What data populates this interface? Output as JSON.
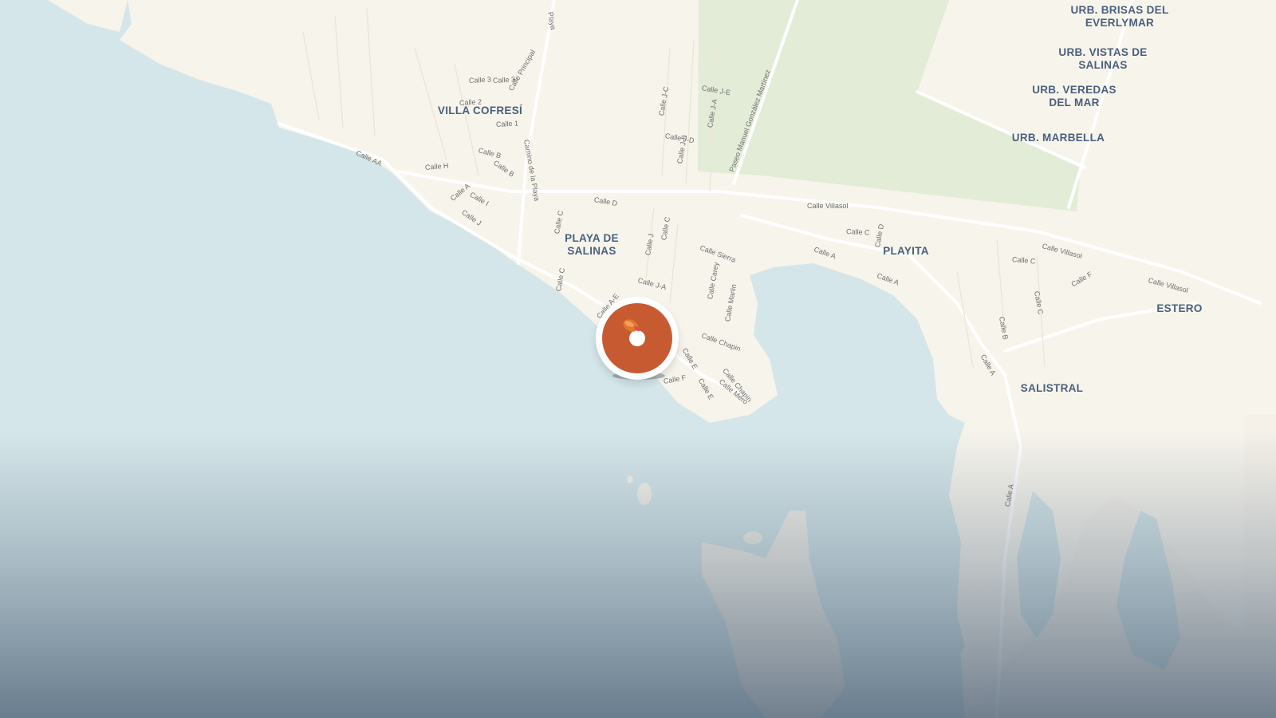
{
  "map": {
    "places": [
      {
        "id": "villa-cofresi",
        "label": "VILLA COFRESÍ"
      },
      {
        "id": "playa-de-salinas",
        "label": "PLAYA DE\nSALINAS"
      },
      {
        "id": "playita",
        "label": "PLAYITA"
      },
      {
        "id": "estero",
        "label": "ESTERO"
      },
      {
        "id": "salistral",
        "label": "SALISTRAL"
      },
      {
        "id": "urb-brisas",
        "label": "URB. BRISAS DEL\nEVERLYMAR"
      },
      {
        "id": "urb-vistas",
        "label": "URB. VISTAS DE\nSALINAS"
      },
      {
        "id": "urb-veredas",
        "label": "URB. VEREDAS\nDEL MAR"
      },
      {
        "id": "urb-marbella",
        "label": "URB. MARBELLA"
      }
    ],
    "streets": [
      "Calle 3",
      "Calle 3",
      "Calle 2",
      "Calle 1",
      "Calle Principal",
      "Camino de la Playa",
      "Playa",
      "Calle AA",
      "Calle H",
      "Calle B",
      "Calle B",
      "Calle A",
      "Calle I",
      "Calle J",
      "Calle C",
      "Calle D",
      "Calle J-E",
      "Calle J-C",
      "Calle J-A",
      "Calle J-D",
      "Calle J-B",
      "Paseo Manuel González Martínez",
      "Calle Villasol",
      "Calle C",
      "Calle D",
      "Calle A",
      "Calle A",
      "Calle Villasol",
      "Calle C",
      "Calle F",
      "Calle Villasol",
      "Calle B",
      "Calle C",
      "Calle A",
      "Calle A",
      "Calle Sierra",
      "Calle J",
      "Calle C",
      "Calle J-A",
      "Calle Carey",
      "Calle Marlin",
      "Calle Chapin",
      "Calle Chapin",
      "Calle E",
      "Calle E",
      "Calle Mero",
      "Calle F",
      "Calle A-E",
      "Calle C",
      "Calle 3"
    ]
  },
  "marker": {
    "icon": "buoy-icon",
    "color": "#c85a32"
  },
  "colors": {
    "land": "#f7f4ec",
    "water": "#d4e6e9",
    "park": "#e3ecd6",
    "road": "#ffffff",
    "label": "#4a5f7d"
  }
}
